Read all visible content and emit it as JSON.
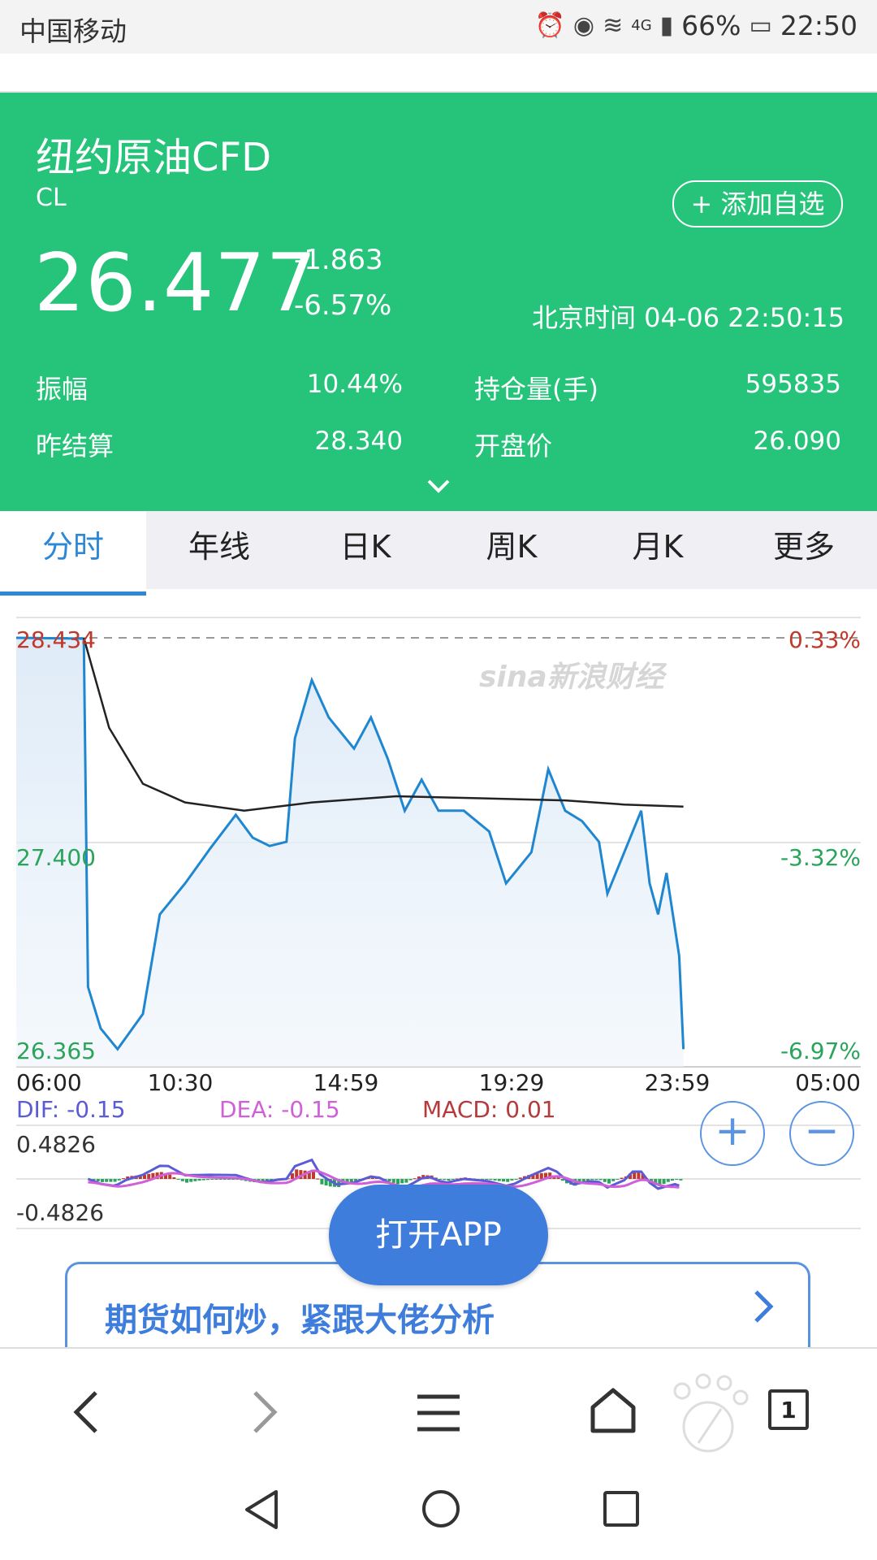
{
  "status_bar": {
    "carrier": "中国移动",
    "network": "4G",
    "battery": "66%",
    "time": "22:50"
  },
  "quote": {
    "name": "纽约原油CFD",
    "code": "CL",
    "add_watch_label": "+ 添加自选",
    "price": "26.477",
    "change_abs": "-1.863",
    "change_pct": "-6.57%",
    "time_label": "北京时间 04-06 22:50:15",
    "stats": [
      {
        "label": "振幅",
        "value": "10.44%"
      },
      {
        "label": "持仓量(手)",
        "value": "595835"
      },
      {
        "label": "昨结算",
        "value": "28.340"
      },
      {
        "label": "开盘价",
        "value": "26.090"
      }
    ]
  },
  "tabs": [
    {
      "label": "分时",
      "active": true
    },
    {
      "label": "年线",
      "active": false
    },
    {
      "label": "日K",
      "active": false
    },
    {
      "label": "周K",
      "active": false
    },
    {
      "label": "月K",
      "active": false
    },
    {
      "label": "更多",
      "active": false
    }
  ],
  "chart_data": {
    "type": "line",
    "watermark": "sina新浪财经",
    "y_left_ticks": [
      "28.434",
      "27.400",
      "26.365"
    ],
    "y_right_ticks": [
      "0.33%",
      "-3.32%",
      "-6.97%"
    ],
    "ylim": [
      26.365,
      28.434
    ],
    "x_ticks": [
      "06:00",
      "10:30",
      "14:59",
      "19:29",
      "23:59",
      "05:00"
    ],
    "series": [
      {
        "key": "price",
        "points": [
          [
            0.0,
            28.434
          ],
          [
            0.08,
            28.43
          ],
          [
            0.085,
            26.75
          ],
          [
            0.1,
            26.55
          ],
          [
            0.12,
            26.45
          ],
          [
            0.15,
            26.62
          ],
          [
            0.17,
            27.1
          ],
          [
            0.2,
            27.25
          ],
          [
            0.23,
            27.42
          ],
          [
            0.26,
            27.58
          ],
          [
            0.28,
            27.47
          ],
          [
            0.3,
            27.43
          ],
          [
            0.32,
            27.45
          ],
          [
            0.33,
            27.95
          ],
          [
            0.35,
            28.23
          ],
          [
            0.37,
            28.05
          ],
          [
            0.4,
            27.9
          ],
          [
            0.42,
            28.05
          ],
          [
            0.44,
            27.85
          ],
          [
            0.46,
            27.6
          ],
          [
            0.48,
            27.75
          ],
          [
            0.5,
            27.6
          ],
          [
            0.53,
            27.6
          ],
          [
            0.56,
            27.5
          ],
          [
            0.58,
            27.25
          ],
          [
            0.61,
            27.4
          ],
          [
            0.63,
            27.8
          ],
          [
            0.65,
            27.6
          ],
          [
            0.67,
            27.55
          ],
          [
            0.69,
            27.45
          ],
          [
            0.7,
            27.2
          ],
          [
            0.72,
            27.4
          ],
          [
            0.74,
            27.6
          ],
          [
            0.75,
            27.25
          ],
          [
            0.76,
            27.1
          ],
          [
            0.77,
            27.3
          ],
          [
            0.785,
            26.9
          ],
          [
            0.79,
            26.45
          ]
        ]
      },
      {
        "key": "avg",
        "points": [
          [
            0.08,
            28.434
          ],
          [
            0.11,
            28.0
          ],
          [
            0.15,
            27.73
          ],
          [
            0.2,
            27.64
          ],
          [
            0.27,
            27.6
          ],
          [
            0.35,
            27.64
          ],
          [
            0.45,
            27.67
          ],
          [
            0.55,
            27.66
          ],
          [
            0.65,
            27.65
          ],
          [
            0.72,
            27.63
          ],
          [
            0.79,
            27.62
          ]
        ]
      }
    ],
    "macd": {
      "dif_label": "DIF: -0.15",
      "dea_label": "DEA: -0.15",
      "macd_label": "MACD: 0.01",
      "upper": "0.4826",
      "lower": "-0.4826"
    },
    "colors": {
      "price": "#1f86d0",
      "avg": "#222222",
      "dif": "#5b5bd6",
      "dea": "#d060d8",
      "macd": "#b73a3a",
      "up": "#c0392b",
      "down": "#2aa45a"
    }
  },
  "open_app_label": "打开APP",
  "ad_text": "期货如何炒，紧跟大佬分析",
  "browser": {
    "tab_count": "1"
  }
}
